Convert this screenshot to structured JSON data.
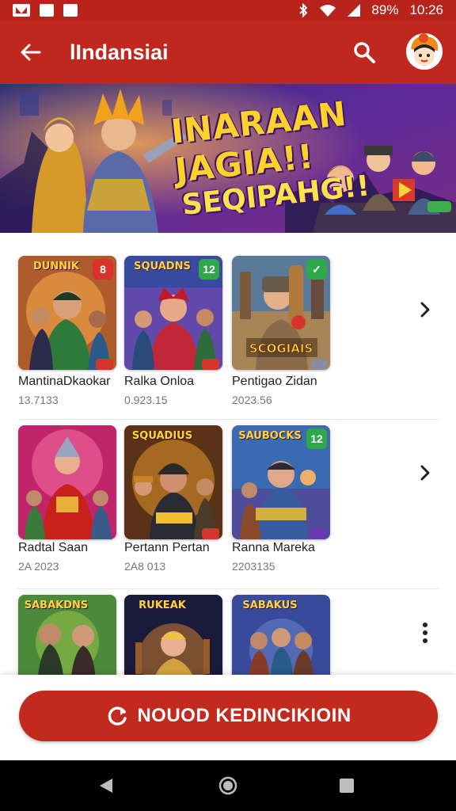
{
  "status_bar": {
    "battery": "89%",
    "time": "10:26"
  },
  "app_bar": {
    "title": "lIndansiai"
  },
  "banner": {
    "line1": "INARAAN JAGIA!!",
    "line2": "SEQIPAHG!!"
  },
  "rows": [
    {
      "items": [
        {
          "logo": "DUNNIK",
          "badge": "8",
          "badge_color": "#d9342b",
          "title": "MantinaDkaokar",
          "meta": "13.7133"
        },
        {
          "logo": "SQUADNS",
          "badge": "12",
          "badge_color": "#2fa84a",
          "title": "Ralka Onloa",
          "meta": "0.923.15"
        },
        {
          "logo": "SCOGIAIS",
          "badge": "✓",
          "badge_color": "#2fa84a",
          "title": "Pentigao Zidan",
          "meta": "2023.56"
        }
      ]
    },
    {
      "items": [
        {
          "logo": "",
          "badge": "",
          "badge_color": "",
          "title": "Radtal Saan",
          "meta": "2A 2023"
        },
        {
          "logo": "SQUADIUS",
          "badge": "",
          "badge_color": "",
          "title": "Pertann Pertan",
          "meta": "2A8 013"
        },
        {
          "logo": "SAUBOCKS",
          "badge": "12",
          "badge_color": "#2fa84a",
          "title": "Ranna Mareka",
          "meta": "2203135"
        }
      ]
    },
    {
      "items": [
        {
          "logo": "SABAKDNS",
          "badge": "",
          "badge_color": "",
          "title": "",
          "meta": ""
        },
        {
          "logo": "RUKEAK",
          "badge": "",
          "badge_color": "",
          "title": "",
          "meta": ""
        },
        {
          "logo": "SABAKUS",
          "badge": "",
          "badge_color": "",
          "title": "",
          "meta": ""
        }
      ]
    }
  ],
  "cta": {
    "label": "NOUOD KEDINCIKIOIN"
  },
  "colors": {
    "primary": "#c0281f",
    "status": "#b8241b"
  },
  "icons": [
    "back-arrow-icon",
    "search-icon",
    "chevron-right-icon",
    "more-vert-icon",
    "refresh-icon",
    "nav-back-icon",
    "nav-home-icon",
    "nav-recents-icon"
  ]
}
